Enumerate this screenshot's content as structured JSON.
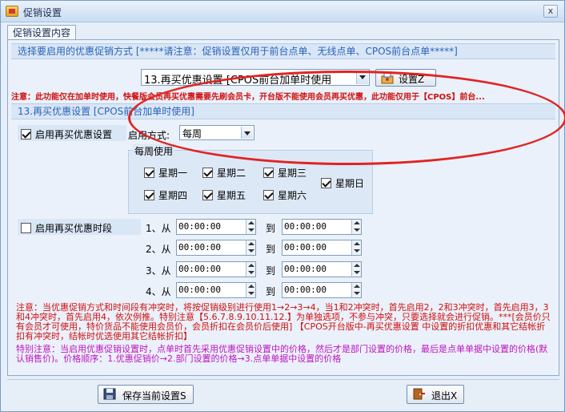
{
  "window": {
    "title": "促销设置",
    "close_label": "x"
  },
  "tab": {
    "label": "促销设置内容"
  },
  "section1": {
    "header": "选择要启用的优惠促销方式  [*****请注意：促销设置仅用于前台点单、无线点单、CPOS前台点单*****]",
    "mode_selected": "13.再买优惠设置 [CPOS前台加单时使用",
    "settings_button": "设置Z",
    "warning": "注意：此功能仅在加单时使用，快餐版会员再买优惠需要先刷会员卡，开台版不能使用会员再买优惠，此功能仅用于【CPOS】前台..."
  },
  "section2": {
    "header": "13.再买优惠设置 [CPOS前台加单时使用]",
    "enable_label": "启用再买优惠设置",
    "enable_checked": true,
    "mode_label": "启用方式:",
    "mode_value": "每周",
    "weekly_title": "每周使用",
    "days": [
      {
        "label": "星期一",
        "checked": true
      },
      {
        "label": "星期二",
        "checked": true
      },
      {
        "label": "星期三",
        "checked": true
      },
      {
        "label": "星期四",
        "checked": true
      },
      {
        "label": "星期五",
        "checked": true
      },
      {
        "label": "星期六",
        "checked": true
      },
      {
        "label": "星期日",
        "checked": true
      }
    ],
    "period_label": "启用再买优惠时段",
    "period_checked": false,
    "periods": [
      {
        "from_label": "1、从",
        "from": "00:00:00",
        "to_label": "到",
        "to": "00:00:00"
      },
      {
        "from_label": "2、从",
        "from": "00:00:00",
        "to_label": "到",
        "to": "00:00:00"
      },
      {
        "from_label": "3、从",
        "from": "00:00:00",
        "to_label": "到",
        "to": "00:00:00"
      },
      {
        "from_label": "4、从",
        "from": "00:00:00",
        "to_label": "到",
        "to": "00:00:00"
      }
    ],
    "note_red": "注意：当优惠促销方式和时间段有冲突时，将按促销级别进行使用1→2→3→4，当1和2冲突时，首先启用2，2和3冲突时，首先启用3，3和4冲突时，首先启用4，依次例推。特别注意【5.6.7.8.9.10.11.12.】为单独选项，不参与冲突，只要选择就会进行促销。***[会员价只有会员才可使用，特价货品不能使用会员价，会员折扣在会员价后使用] 【CPOS开台版中-再买优惠设置 中设置的折扣优惠和其它结帐折扣有冲突时，结帐时优选使用其它结帐折扣】",
    "note_magenta": "特别注意：当启用优惠促销设置时，点单时首先采用优惠促销设置中的价格，然后才是部门设置的价格，最后是点单单据中设置的价格(默认销售价)。价格顺序：1.优惠促销价→2.部门设置的价格→3.点单单据中设置的价格"
  },
  "footer": {
    "save_label": "保存当前设置S",
    "exit_label": "退出X"
  },
  "colors": {
    "accent_blue": "#2a64b8",
    "warning_red": "#d01010",
    "note_magenta": "#c014c0",
    "highlight_ellipse": "#e02424"
  }
}
